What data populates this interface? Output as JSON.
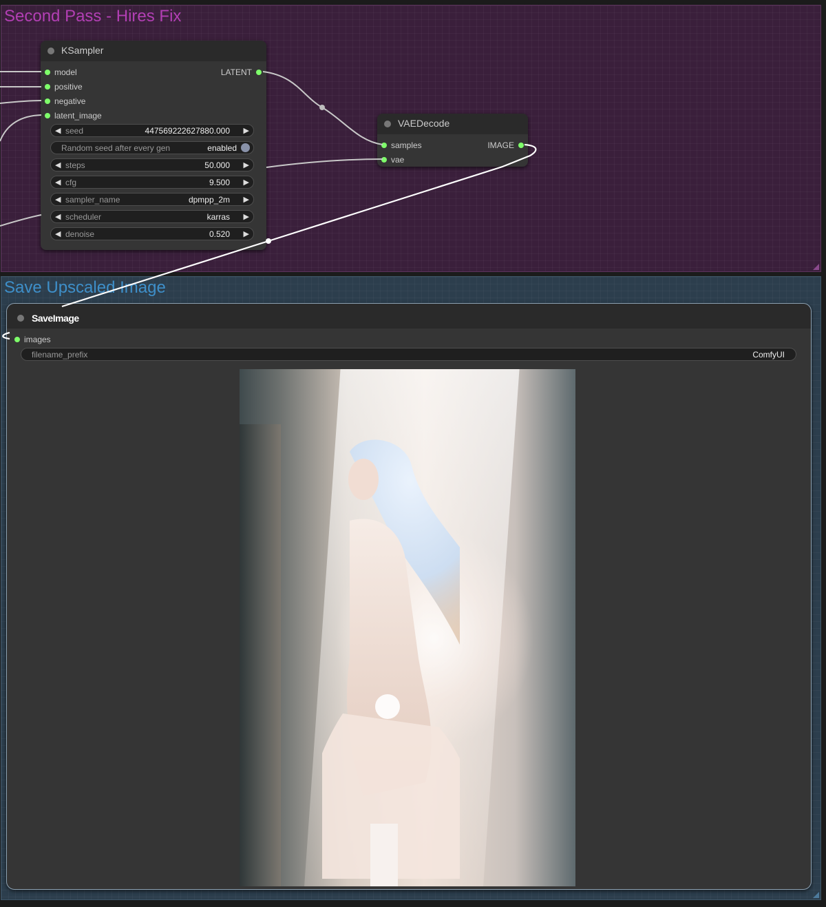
{
  "groups": {
    "hires": {
      "title": "Second Pass - Hires Fix"
    },
    "save": {
      "title": "Save Upscaled Image"
    }
  },
  "ksampler": {
    "title": "KSampler",
    "inputs": [
      "model",
      "positive",
      "negative",
      "latent_image"
    ],
    "output": "LATENT",
    "widgets": {
      "seed": {
        "label": "seed",
        "value": "447569222627880.000"
      },
      "random_seed": {
        "label": "Random seed after every gen",
        "value": "enabled"
      },
      "steps": {
        "label": "steps",
        "value": "50.000"
      },
      "cfg": {
        "label": "cfg",
        "value": "9.500"
      },
      "sampler_name": {
        "label": "sampler_name",
        "value": "dpmpp_2m"
      },
      "scheduler": {
        "label": "scheduler",
        "value": "karras"
      },
      "denoise": {
        "label": "denoise",
        "value": "0.520"
      }
    }
  },
  "vaedecode": {
    "title": "VAEDecode",
    "inputs": [
      "samples",
      "vae"
    ],
    "output": "IMAGE"
  },
  "saveimage": {
    "title": "SaveImage",
    "input": "images",
    "filename_prefix": {
      "label": "filename_prefix",
      "value": "ComfyUI"
    }
  },
  "colors": {
    "slot_dot": "#7eff6a",
    "hires_group_bg": "#3a1f3b",
    "hires_group_title": "#b23fb4",
    "save_group_bg": "#2c3e4d",
    "save_group_title": "#3e8fc9",
    "node_bg": "#353535"
  }
}
